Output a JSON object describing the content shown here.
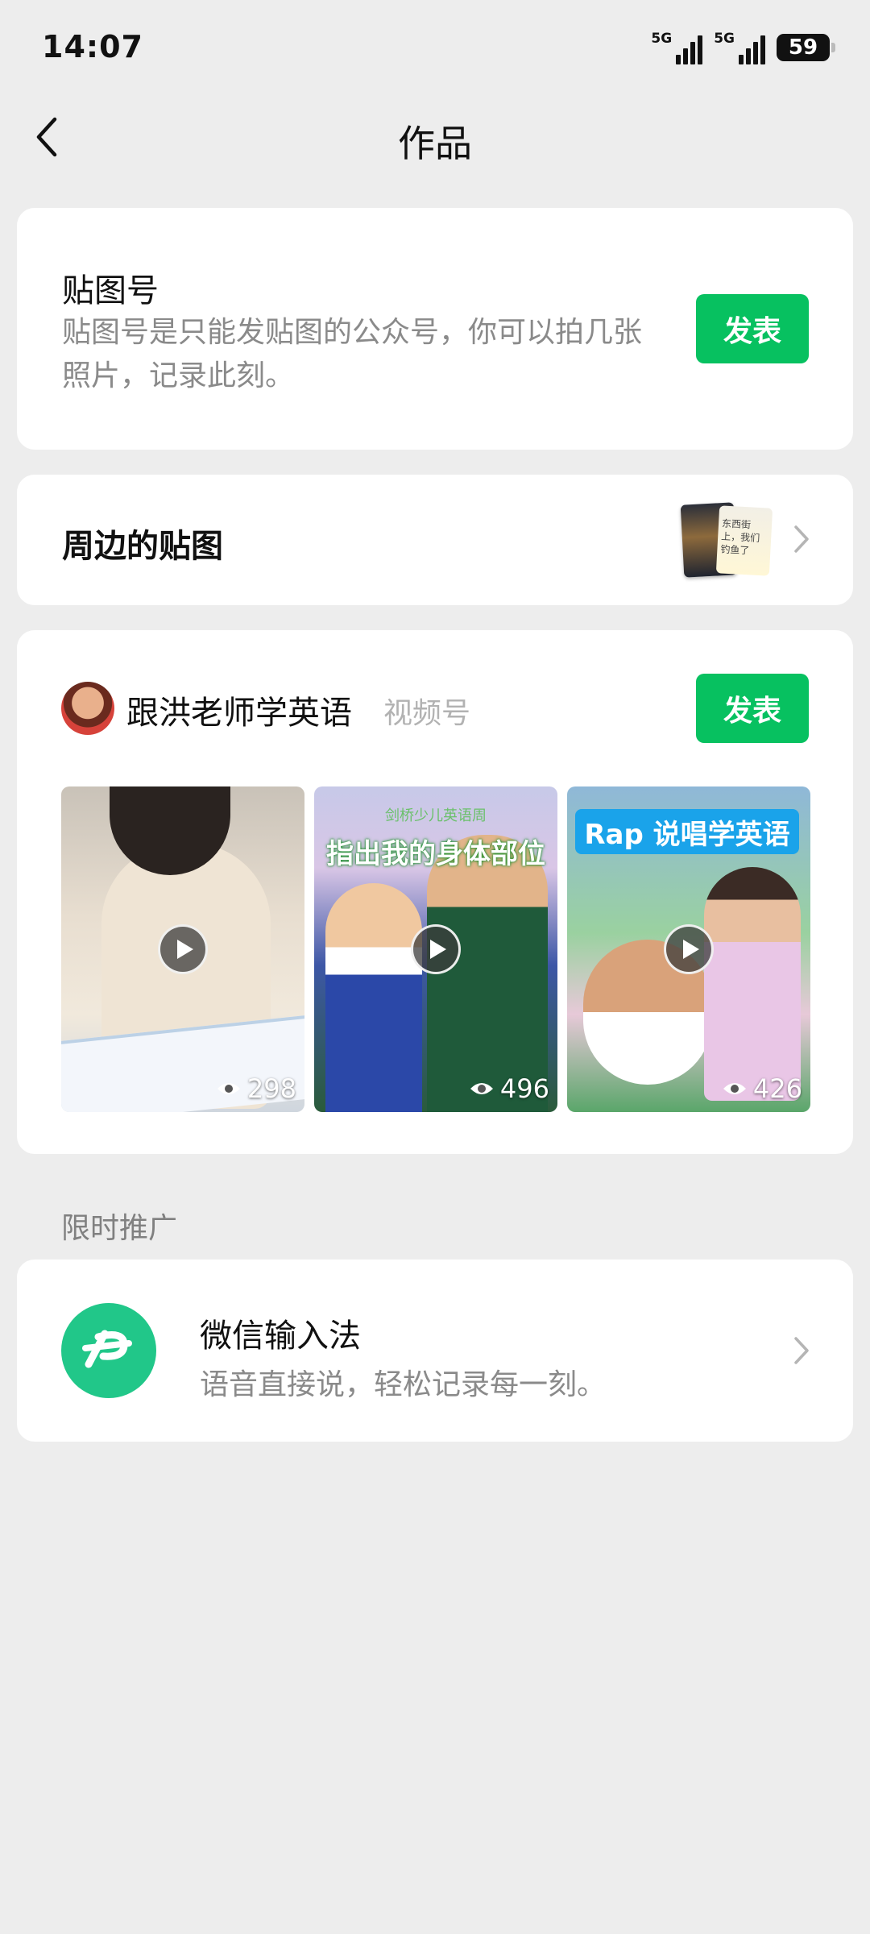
{
  "status_bar": {
    "time": "14:07",
    "network1": "5G",
    "network2": "5G",
    "battery": "59"
  },
  "navbar": {
    "title": "作品"
  },
  "sticker_account": {
    "title": "贴图号",
    "description": "贴图号是只能发贴图的公众号，你可以拍几张照片，记录此刻。",
    "publish_label": "发表"
  },
  "nearby": {
    "title": "周边的贴图",
    "thumb_text": "东西街上，我们钓鱼了"
  },
  "channel": {
    "name": "跟洪老师学英语",
    "type": "视频号",
    "publish_label": "发表",
    "videos": [
      {
        "views": "298",
        "caption": ""
      },
      {
        "views": "496",
        "caption": "指出我的身体部位",
        "subcaption": "剑桥少儿英语周"
      },
      {
        "views": "426",
        "caption": "Rap 说唱学英语"
      }
    ]
  },
  "promo": {
    "section_label": "限时推广",
    "title": "微信输入法",
    "description": "语音直接说，轻松记录每一刻。"
  },
  "colors": {
    "accent": "#07c160",
    "background": "#ededed",
    "ime_logo": "#21c789"
  }
}
